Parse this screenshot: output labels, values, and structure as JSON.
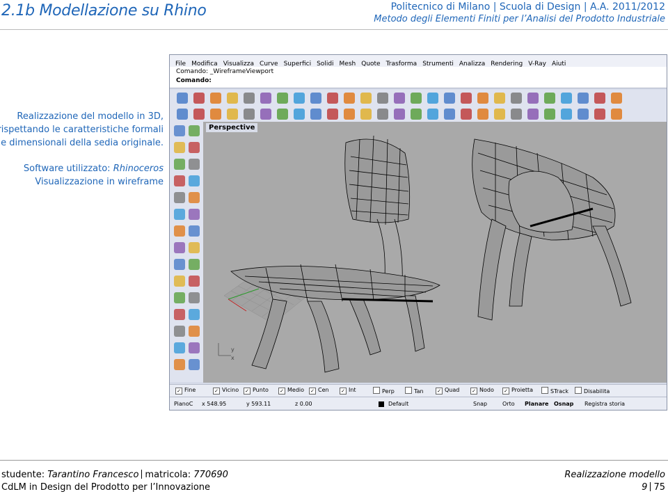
{
  "header": {
    "title": "2.1b Modellazione su Rhino",
    "right_line1": "Politecnico di Milano | Scuola di Design | A.A. 2011/2012",
    "right_line2": "Metodo degli Elementi Finiti per l’Analisi del Prodotto Industriale"
  },
  "description": {
    "line1": "Realizzazione del modello in 3D,",
    "line2": "rispettando le caratteristiche formali",
    "line3": "e dimensionali della sedia originale.",
    "software_prefix": "Software utilizzato: ",
    "software_name": "Rhinoceros",
    "mode": "Visualizzazione in wireframe"
  },
  "rhino": {
    "menu": [
      "File",
      "Modifica",
      "Visualizza",
      "Curve",
      "Superfici",
      "Solidi",
      "Mesh",
      "Quote",
      "Trasforma",
      "Strumenti",
      "Analizza",
      "Rendering",
      "V-Ray",
      "Aiuti"
    ],
    "command_history": "Comando: _WireframeViewport",
    "command_prompt": "Comando:",
    "viewport_label": "Perspective",
    "osnap": [
      "Fine",
      "Vicino",
      "Punto",
      "Medio",
      "Cen",
      "Int",
      "Perp",
      "Tan",
      "Quad",
      "Nodo",
      "Proietta",
      "STrack",
      "Disabilita"
    ],
    "osnap_checked": [
      true,
      true,
      true,
      true,
      true,
      true,
      false,
      false,
      true,
      true,
      true,
      false,
      false
    ],
    "status": {
      "cplane": "PianoC",
      "x": "x 548.95",
      "y": "y 593.11",
      "z": "z 0.00",
      "layer": "Default",
      "snap": "Snap",
      "orto": "Orto",
      "planare": "Planare",
      "osnap": "Osnap",
      "history": "Registra storia"
    },
    "axis_y": "y",
    "axis_x": "x"
  },
  "footer": {
    "student_label": "studente: ",
    "student_name": "Tarantino Francesco",
    "matricola_label": "matricola: ",
    "matricola": "770690",
    "course": "CdLM in Design del Prodotto per l’Innovazione",
    "section": "Realizzazione modello",
    "page": "9",
    "total": "75"
  }
}
